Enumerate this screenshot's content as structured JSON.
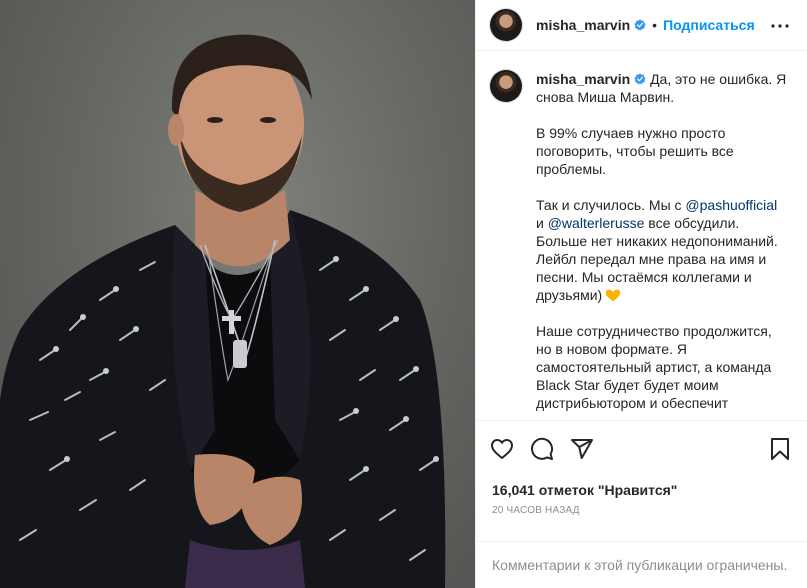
{
  "colors": {
    "accent": "#0095f6",
    "verified": "#3897f0",
    "mention": "#00376b",
    "muted": "#8e8e8e"
  },
  "photo": {
    "alt_icon": "portrait-photo"
  },
  "header": {
    "username": "misha_marvin",
    "separator": "•",
    "follow_label": "Подписаться",
    "more_icon": "more-options-icon"
  },
  "caption": {
    "username": "misha_marvin",
    "line1": "Да, это не ошибка. Я снова Миша Марвин.",
    "para2": "В 99% случаев нужно просто поговорить, чтобы решить все проблемы.",
    "para3_a": "Так и случилось. Мы с ",
    "mention1": "@pashuofficial",
    "para3_b": " и ",
    "mention2": "@walterlerusse",
    "para3_c": " все обсудили. Больше нет никаких недопониманий. Лейбл передал мне права на имя и песни. Мы остаёмся коллегами и друзьями)",
    "para4": "Наше сотрудничество продолжится, но в новом формате. Я самостоятельный артист, а команда Black Star будет будет моим дистрибьютором и обеспечит"
  },
  "actions": [
    "like-icon",
    "comment-icon",
    "share-icon",
    "save-icon"
  ],
  "likes": {
    "count": "16,041",
    "label": "отметок \"Нравится\""
  },
  "time": "20 ЧАСОВ НАЗАД",
  "comments_notice": "Комментарии к этой публикации ограничены."
}
